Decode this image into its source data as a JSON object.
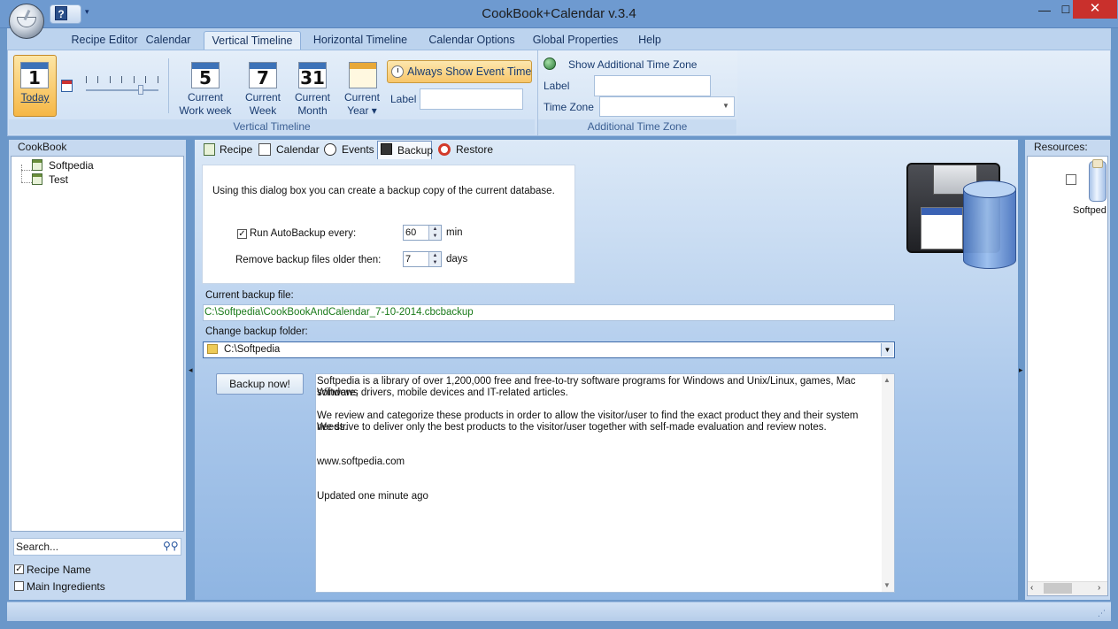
{
  "window": {
    "title": "CookBook+Calendar v.3.4",
    "min": "—",
    "max": "☐",
    "close": "✕"
  },
  "qat": {
    "help": "?",
    "dropdown": "▾"
  },
  "menu": {
    "tabs": [
      "Recipe Editor",
      "Calendar",
      "Vertical Timeline",
      "Horizontal Timeline",
      "Calendar Options",
      "Global Properties",
      "Help"
    ],
    "active": "Vertical Timeline"
  },
  "ribbon": {
    "today": {
      "num": "1",
      "label": "Today"
    },
    "current_work_week": {
      "num": "5",
      "label1": "Current",
      "label2": "Work week"
    },
    "current_week": {
      "num": "7",
      "label1": "Current",
      "label2": "Week"
    },
    "current_month": {
      "num": "31",
      "label1": "Current",
      "label2": "Month"
    },
    "current_year": {
      "label1": "Current",
      "label2": "Year ▾"
    },
    "always_show": "Always Show Event Time",
    "label_text": "Label",
    "group_vertical": "Vertical Timeline",
    "show_tz": "Show Additional Time Zone",
    "tz_label": "Label",
    "tz_zone": "Time Zone",
    "group_tz": "Additional Time Zone"
  },
  "left": {
    "title": "CookBook",
    "tree": [
      "Softpedia",
      "Test"
    ],
    "search_placeholder": "Search...",
    "recipe_name": "Recipe Name",
    "recipe_name_checked": true,
    "main_ingredients": "Main Ingredients",
    "main_ingredients_checked": false
  },
  "center": {
    "tabs": [
      "Recipe",
      "Calendar",
      "Events",
      "Backup",
      "Restore"
    ],
    "active_tab": "Backup",
    "intro": "Using this dialog box you can create a backup copy of the current database.",
    "autobackup_label": "Run AutoBackup every:",
    "autobackup_checked": true,
    "autobackup_value": "60",
    "autobackup_unit": "min",
    "remove_label": "Remove backup files older then:",
    "remove_value": "7",
    "remove_unit": "days",
    "current_file_label": "Current backup file:",
    "current_file": "C:\\Softpedia\\CookBookAndCalendar_7-10-2014.cbcbackup",
    "change_folder_label": "Change backup folder:",
    "change_folder": "C:\\Softpedia",
    "backup_button": "Backup now!",
    "info": [
      "Softpedia is a library of over 1,200,000 free and free-to-try software programs for Windows and Unix/Linux, games, Mac software,",
      "Windows drivers, mobile devices and IT-related articles.",
      "We review and categorize these products in order to allow the visitor/user to find the exact product they and their system needs.",
      "We strive to deliver only the best products to the visitor/user together with self-made evaluation and review notes.",
      "www.softpedia.com",
      "Updated one minute ago"
    ]
  },
  "right": {
    "title": "Resources:",
    "item": "Softped"
  },
  "colors": {
    "frame": "#6b97c9",
    "ribbon": "#dce9f7",
    "highlight": "#f6b746",
    "close": "#c9302c"
  }
}
